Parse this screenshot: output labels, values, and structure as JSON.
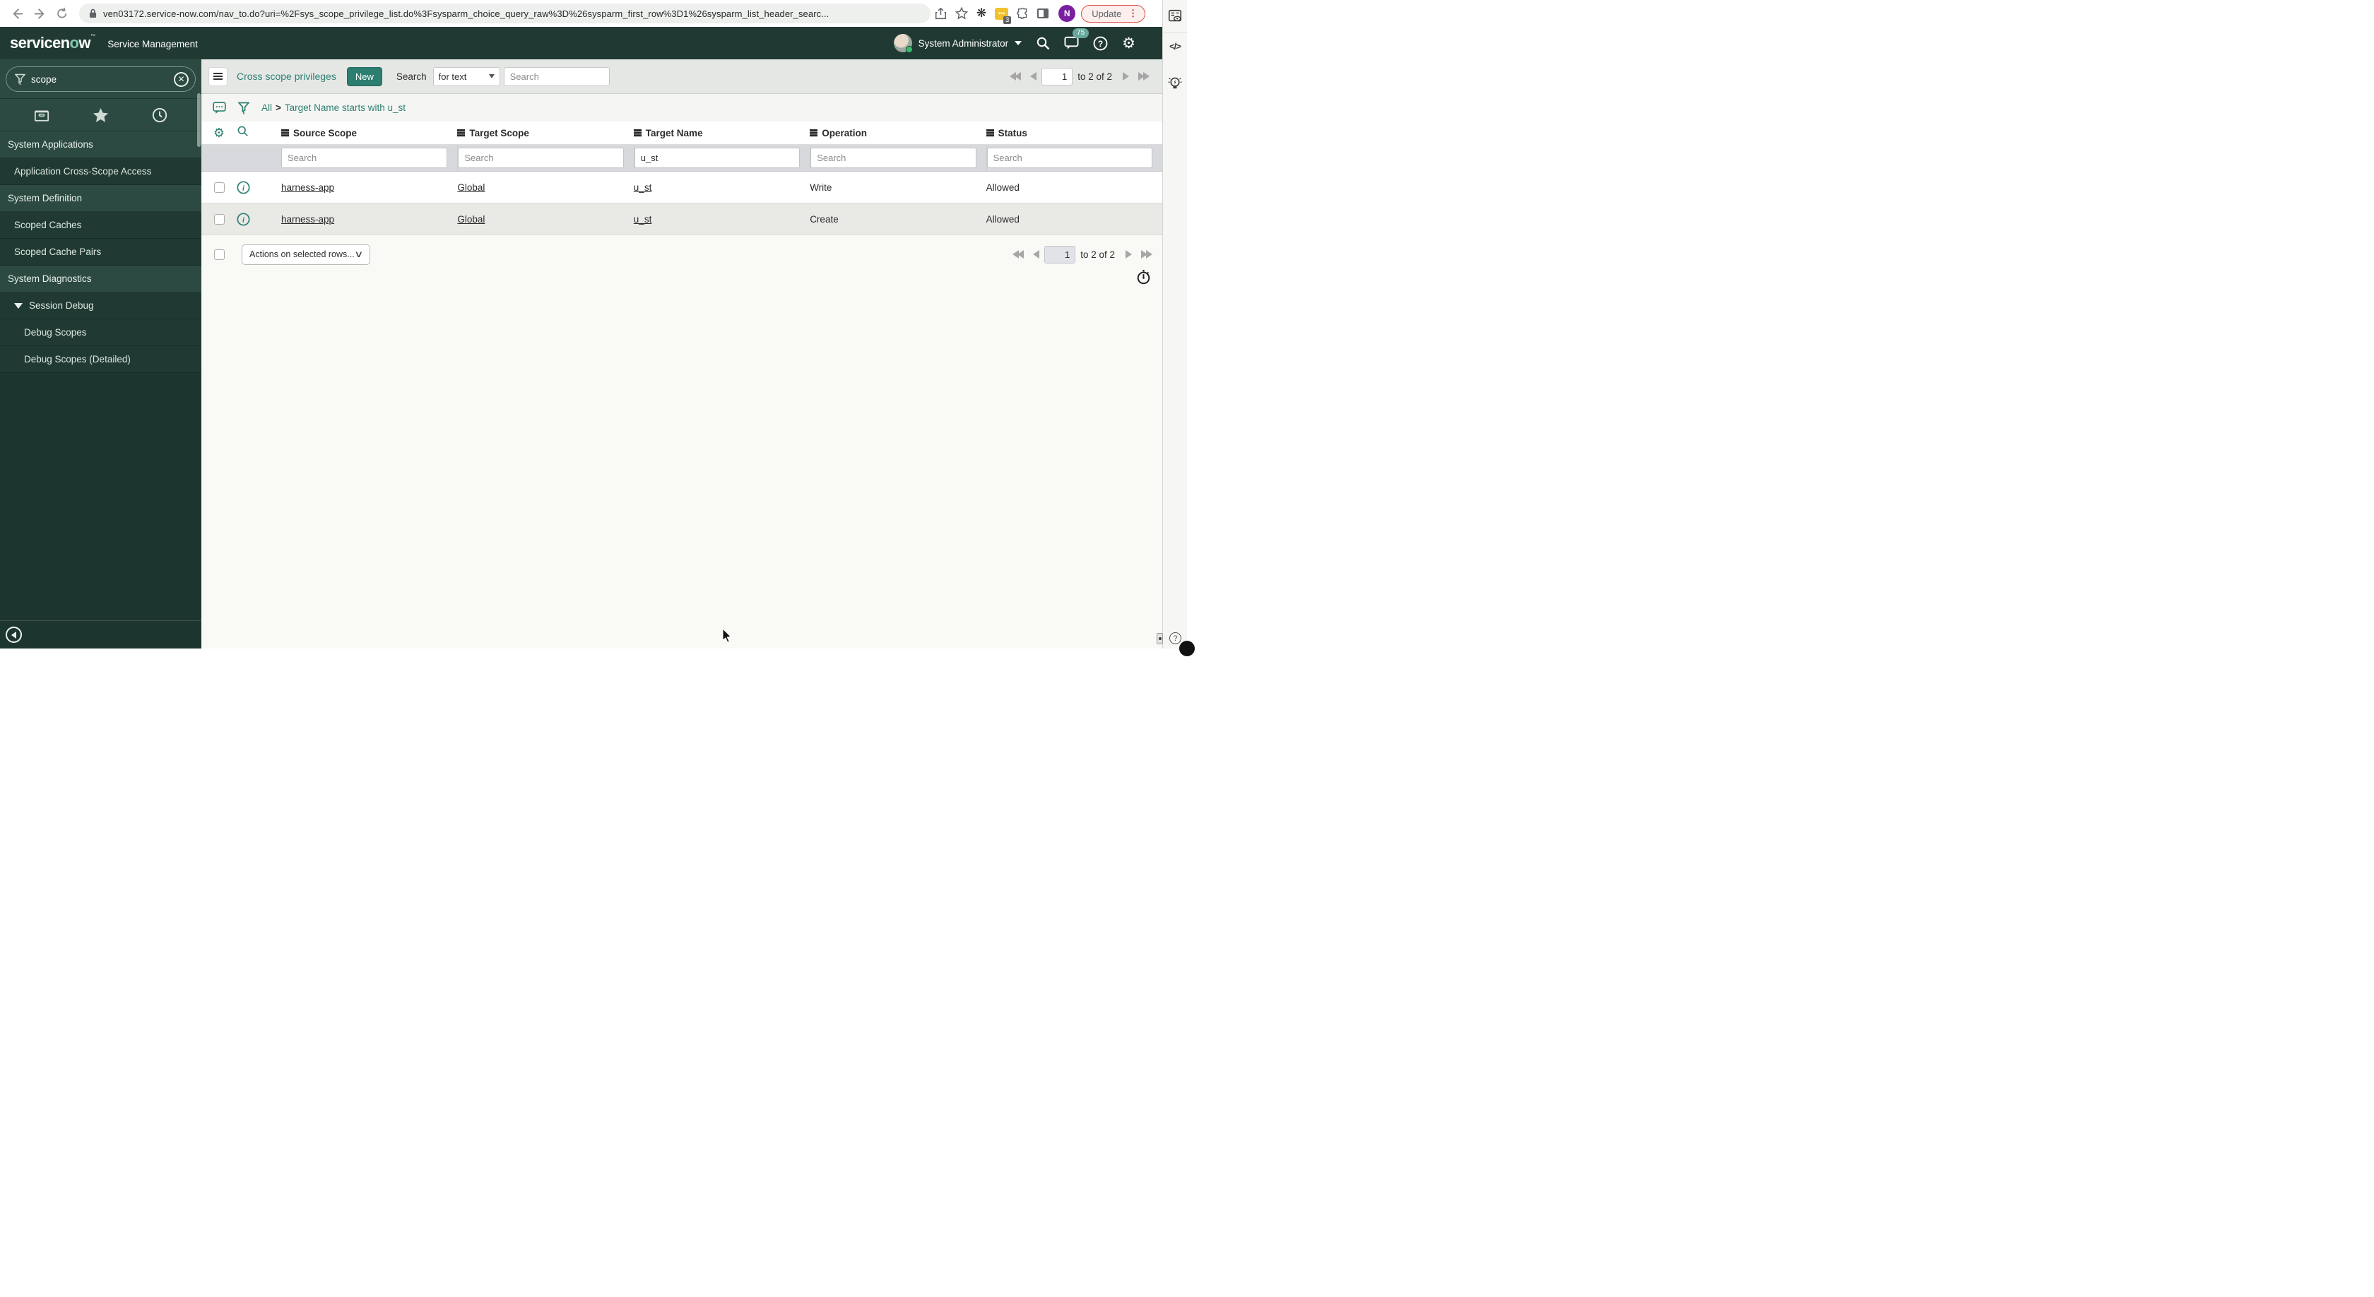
{
  "browser": {
    "url": "ven03172.service-now.com/nav_to.do?uri=%2Fsys_scope_privilege_list.do%3Fsysparm_choice_query_raw%3D%26sysparm_first_row%3D1%26sysparm_list_header_searc...",
    "update_label": "Update",
    "extension_badge": "3",
    "profile_initial": "N"
  },
  "header": {
    "logo_pre": "servicen",
    "logo_o": "o",
    "logo_post": "w",
    "product": "Service Management",
    "user": "System Administrator",
    "notification_count": "75"
  },
  "sidebar": {
    "filter_value": "scope",
    "items": [
      {
        "label": "System Applications",
        "type": "header"
      },
      {
        "label": "Application Cross-Scope Access",
        "type": "item"
      },
      {
        "label": "System Definition",
        "type": "header"
      },
      {
        "label": "Scoped Caches",
        "type": "item"
      },
      {
        "label": "Scoped Cache Pairs",
        "type": "item"
      },
      {
        "label": "System Diagnostics",
        "type": "header"
      },
      {
        "label": "Session Debug",
        "type": "expanded"
      },
      {
        "label": "Debug Scopes",
        "type": "subitem"
      },
      {
        "label": "Debug Scopes (Detailed)",
        "type": "subitem"
      }
    ]
  },
  "toolbar": {
    "title": "Cross scope privileges",
    "new_label": "New",
    "search_label": "Search",
    "search_type": "for text",
    "search_placeholder": "Search"
  },
  "breadcrumb": {
    "all": "All",
    "sep": ">",
    "filter": "Target Name starts with u_st"
  },
  "pagination": {
    "page": "1",
    "range": "to 2 of 2"
  },
  "list": {
    "columns": [
      "Source Scope",
      "Target Scope",
      "Target Name",
      "Operation",
      "Status"
    ],
    "filter_placeholder": "Search",
    "filter_target_name": "u_st",
    "rows": [
      {
        "source_scope": "harness-app",
        "target_scope": "Global",
        "target_name": "u_st",
        "operation": "Write",
        "status": "Allowed"
      },
      {
        "source_scope": "harness-app",
        "target_scope": "Global",
        "target_name": "u_st",
        "operation": "Create",
        "status": "Allowed"
      }
    ],
    "actions_label": "Actions on selected rows..."
  },
  "rail": {
    "code_glyph": "</>"
  },
  "colors": {
    "accent_teal": "#2e8073",
    "banner_green": "#203a33",
    "update_red": "#dd4b42",
    "avatar_purple": "#7b1fa2",
    "extension_yellow": "#f2c12e",
    "badge_teal": "#68a79b"
  }
}
